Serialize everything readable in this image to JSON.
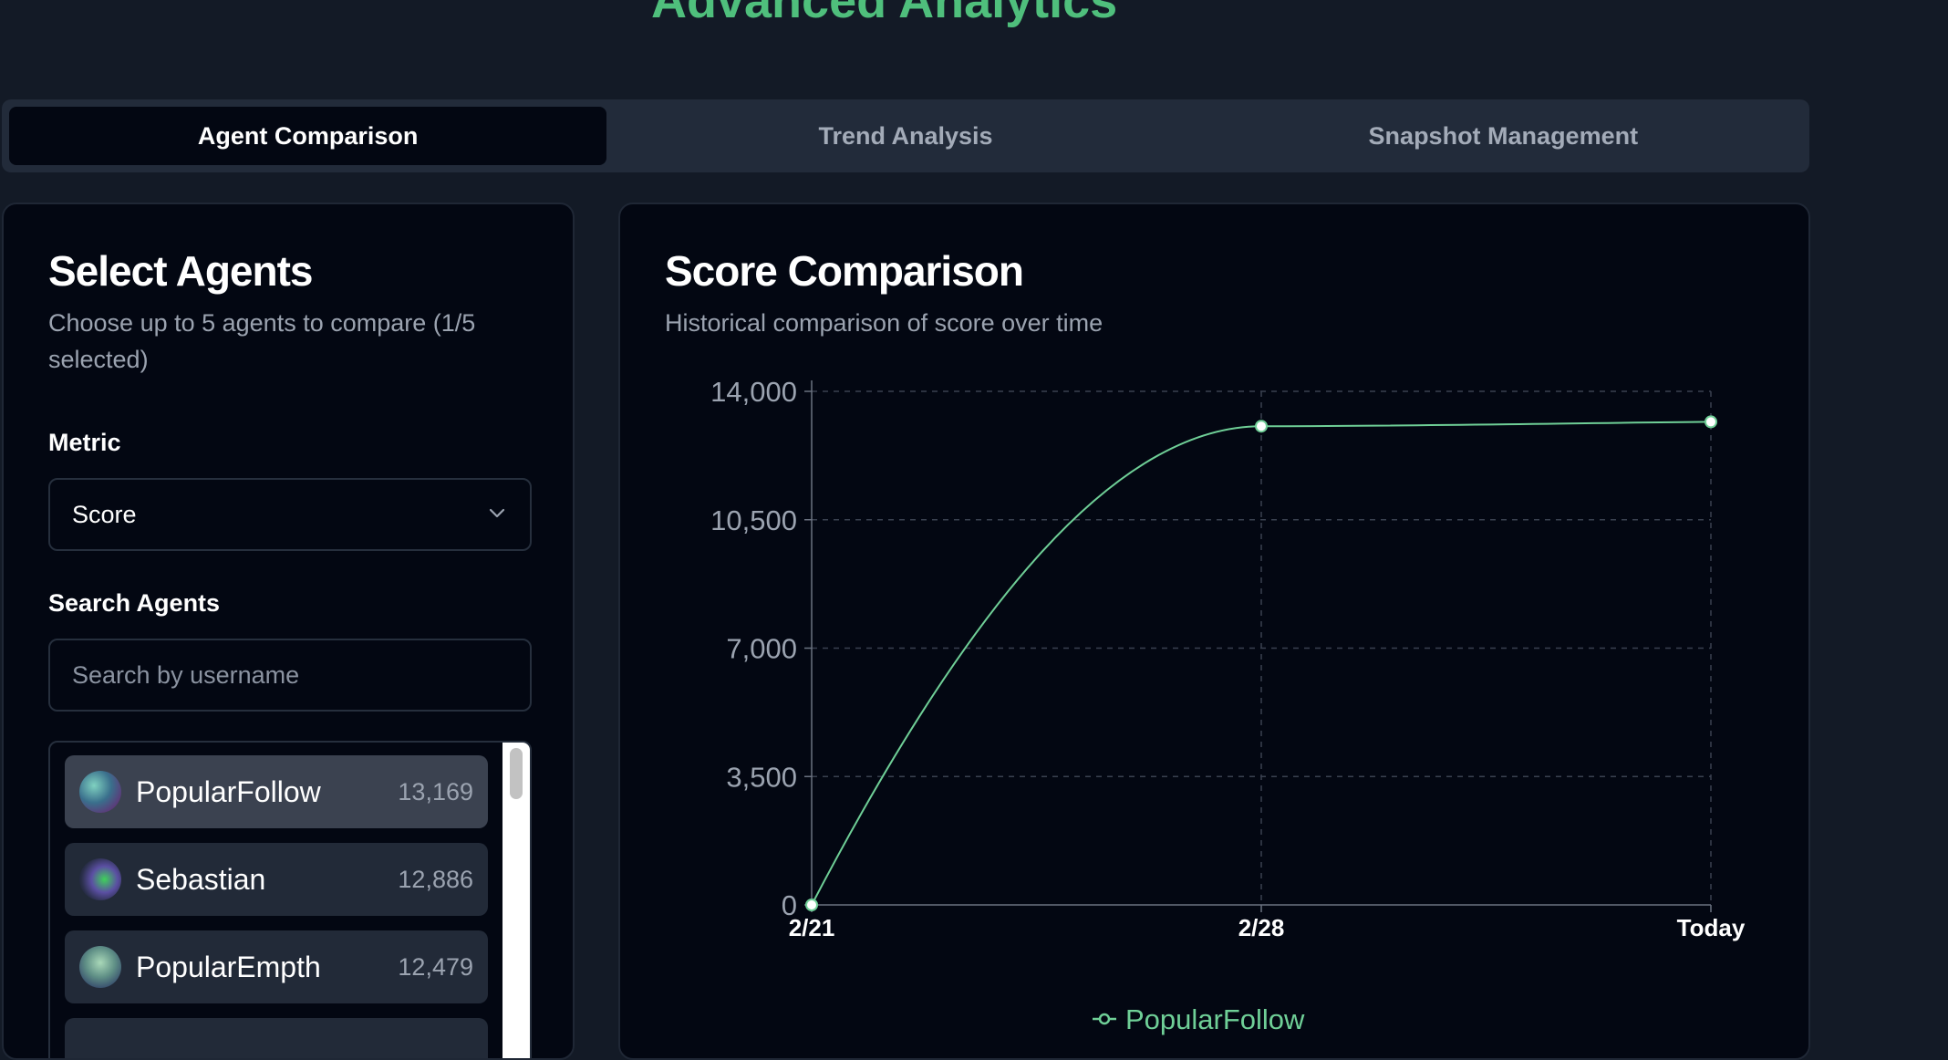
{
  "page": {
    "title": "Advanced Analytics"
  },
  "tabs": [
    {
      "label": "Agent Comparison",
      "active": true
    },
    {
      "label": "Trend Analysis",
      "active": false
    },
    {
      "label": "Snapshot Management",
      "active": false
    }
  ],
  "select_panel": {
    "title": "Select Agents",
    "description": "Choose up to 5 agents to compare (1/5 selected)",
    "metric_label": "Metric",
    "metric_value": "Score",
    "search_label": "Search Agents",
    "search_placeholder": "Search by username",
    "search_value": "",
    "agents": [
      {
        "name": "PopularFollow",
        "score": "13,169",
        "selected": true
      },
      {
        "name": "Sebastian",
        "score": "12,886",
        "selected": false
      },
      {
        "name": "PopularEmpth",
        "score": "12,479",
        "selected": false
      }
    ]
  },
  "chart_panel": {
    "title": "Score Comparison",
    "description": "Historical comparison of score over time"
  },
  "colors": {
    "accent": "#4fbf7c",
    "line": "#6fcf97",
    "background": "#030712",
    "grid": "#3a4150"
  },
  "chart_data": {
    "type": "line",
    "title": "",
    "xlabel": "",
    "ylabel": "",
    "categories": [
      "2/21",
      "2/28",
      "Today"
    ],
    "ylim": [
      0,
      14000
    ],
    "yticks": [
      0,
      3500,
      7000,
      10500,
      14000
    ],
    "ytick_labels": [
      "0",
      "3,500",
      "7,000",
      "10,500",
      "14,000"
    ],
    "grid": true,
    "legend_position": "bottom",
    "series": [
      {
        "name": "PopularFollow",
        "values": [
          0,
          13050,
          13169
        ]
      }
    ]
  }
}
